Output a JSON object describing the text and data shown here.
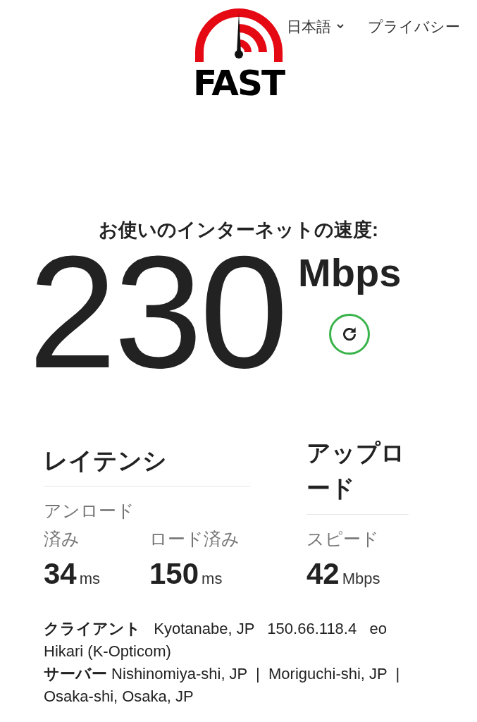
{
  "header": {
    "logo": "FAST",
    "language": "日本語",
    "privacy": "プライバシー"
  },
  "speed": {
    "title": "お使いのインターネットの速度:",
    "value": "230",
    "unit": "Mbps"
  },
  "latency": {
    "title": "レイテンシ",
    "metrics": [
      {
        "label": "アンロード済み",
        "value": "34",
        "unit": "ms"
      },
      {
        "label": "ロード済み",
        "value": "150",
        "unit": "ms"
      }
    ]
  },
  "upload": {
    "title": "アップロード",
    "metrics": [
      {
        "label": "スピード",
        "value": "42",
        "unit": "Mbps"
      }
    ]
  },
  "info": [
    "**クライアント**   Kyotanabe, JP   150.66.118.4   eo Hikari (K-Opticom)",
    "**サーバー** Nishinomiya-shi, JP  |  Moriguchi-shi, JP  |  Osaka-shi, Osaka, JP"
  ]
}
